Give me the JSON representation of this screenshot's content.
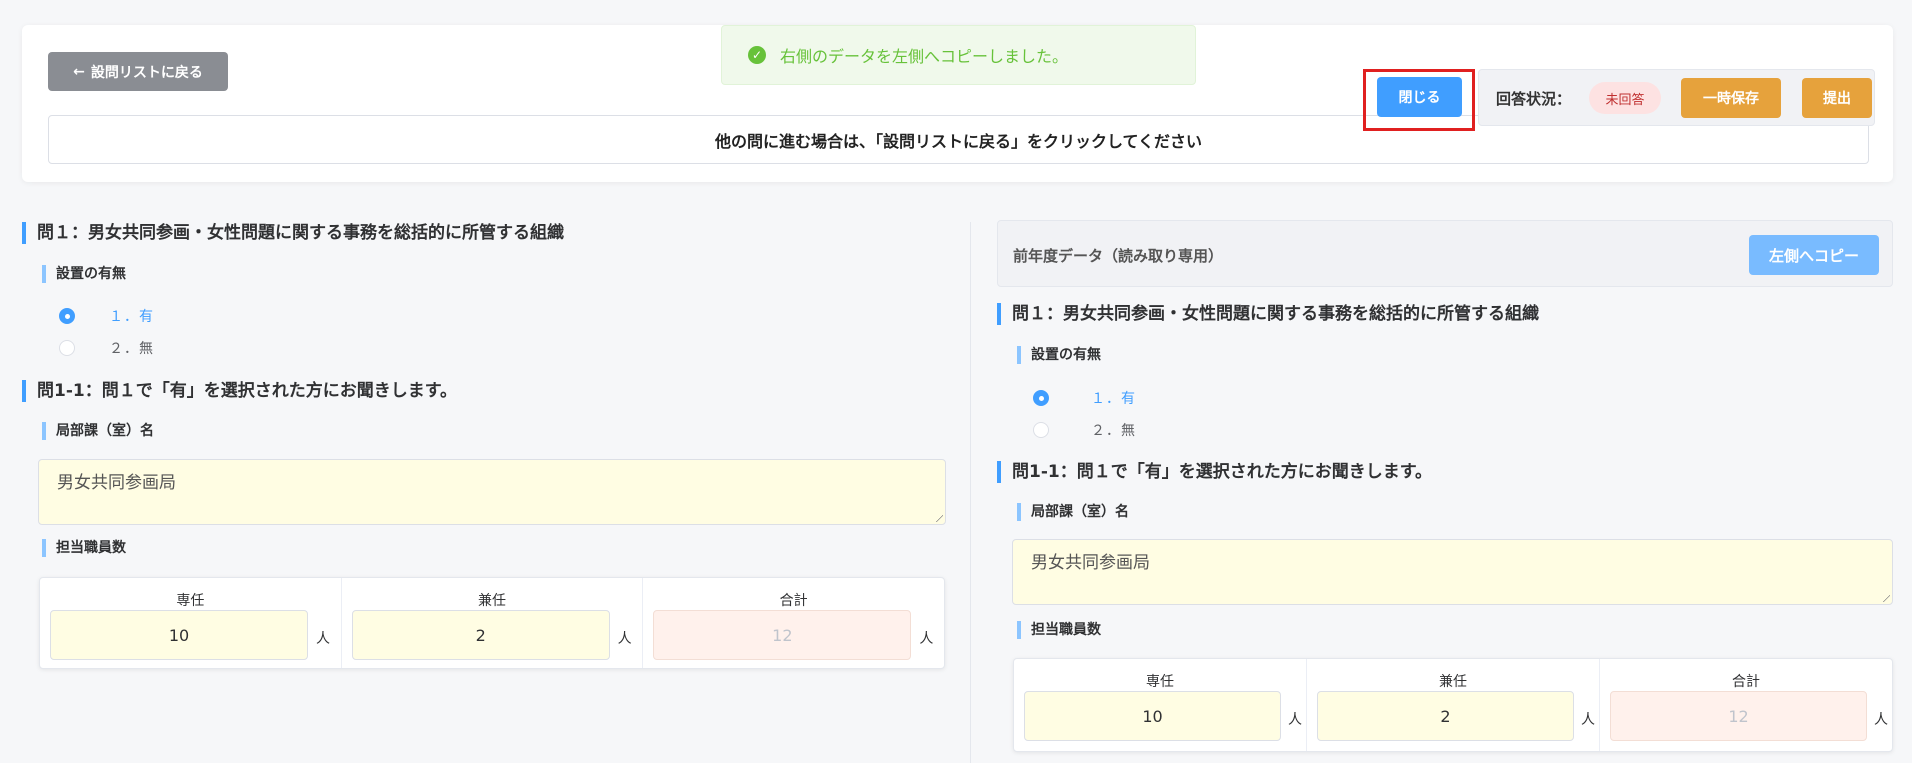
{
  "header": {
    "back_label": "設問リストに戻る",
    "notice": "他の問に進む場合は、「設問リストに戻る」をクリックしてください",
    "close_label": "閉じる",
    "status_label": "回答状況：",
    "status_value": "未回答",
    "save_label": "一時保存",
    "submit_label": "提出"
  },
  "toast": {
    "message": "右側のデータを左側へコピーしました。",
    "icon": "check-circle-icon",
    "color": "#67c23a"
  },
  "left": {
    "q1_title": "問１：男女共同参画・女性問題に関する事務を総括的に所管する組織",
    "q1_sub": "設置の有無",
    "options": [
      "１．有",
      "２．無"
    ],
    "selected_index": 0,
    "q11_title": "問1-1：問１で「有」を選択された方にお聞きします。",
    "dept_label": "局部課（室）名",
    "dept_value": "男女共同参画局",
    "staff_label": "担当職員数",
    "staff": {
      "full_label": "専任",
      "full_value": "10",
      "part_label": "兼任",
      "part_value": "2",
      "total_label": "合計",
      "total_value": "12",
      "unit": "人"
    }
  },
  "right": {
    "header_label": "前年度データ（読み取り専用）",
    "copy_label": "左側へコピー",
    "q1_title": "問１：男女共同参画・女性問題に関する事務を総括的に所管する組織",
    "q1_sub": "設置の有無",
    "options": [
      "１．有",
      "２．無"
    ],
    "selected_index": 0,
    "q11_title": "問1-1：問１で「有」を選択された方にお聞きします。",
    "dept_label": "局部課（室）名",
    "dept_value": "男女共同参画局",
    "staff_label": "担当職員数",
    "staff": {
      "full_label": "専任",
      "full_value": "10",
      "part_label": "兼任",
      "part_value": "2",
      "total_label": "合計",
      "total_value": "12",
      "unit": "人"
    }
  },
  "colors": {
    "primary": "#409eff",
    "warning": "#e6a23c",
    "highlight": "#e02020",
    "input_bg": "#fffde3"
  }
}
